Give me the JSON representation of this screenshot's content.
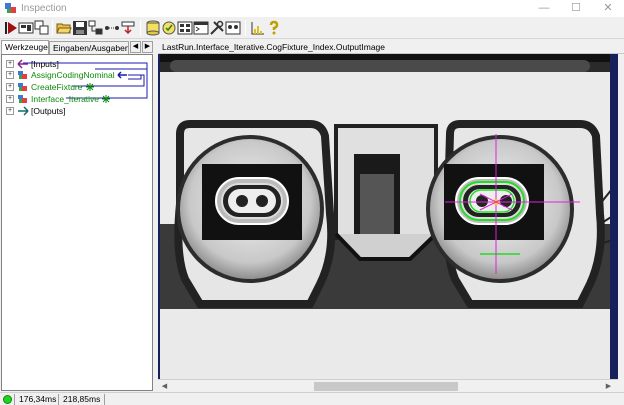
{
  "window": {
    "title": "Inspection",
    "min_glyph": "—",
    "max_glyph": "☐",
    "close_glyph": "✕"
  },
  "toolbar": {
    "icons": [
      "run-icon",
      "display-icon",
      "tools-icon",
      "open-icon",
      "save-icon",
      "tree-icon",
      "link-icon",
      "io-icon",
      "database-icon",
      "results-icon",
      "grid-icon",
      "terminal-icon",
      "wrench-icon",
      "image-icon",
      "chart-icon",
      "help-icon"
    ]
  },
  "left_panel": {
    "tabs": [
      {
        "label": "Werkzeuge",
        "active": true
      },
      {
        "label": "Eingaben/Ausgaben",
        "active": false
      }
    ],
    "arrow_left": "◀",
    "arrow_right": "▶",
    "tree": [
      {
        "label": "[Inputs]",
        "expander": "+",
        "color": "black"
      },
      {
        "label": "AssignCodingNominal",
        "expander": "+",
        "color": "green"
      },
      {
        "label": "CreateFixture",
        "expander": "+",
        "color": "green"
      },
      {
        "label": "Interface_Iterative",
        "expander": "+",
        "color": "green"
      },
      {
        "label": "[Outputs]",
        "expander": "+",
        "color": "black"
      }
    ]
  },
  "image_panel": {
    "header": "LastRun.Interface_Iterative.CogFixture_Index.OutputImage",
    "scroll_left": "◀",
    "scroll_right": "▶"
  },
  "status": {
    "time1": "176,34ms",
    "time2": "218,85ms"
  },
  "colors": {
    "accent_green": "#0b8a0b",
    "link_blue": "#1a1ab0",
    "viewer_border": "#17205a",
    "led_green": "#1fd41f"
  }
}
